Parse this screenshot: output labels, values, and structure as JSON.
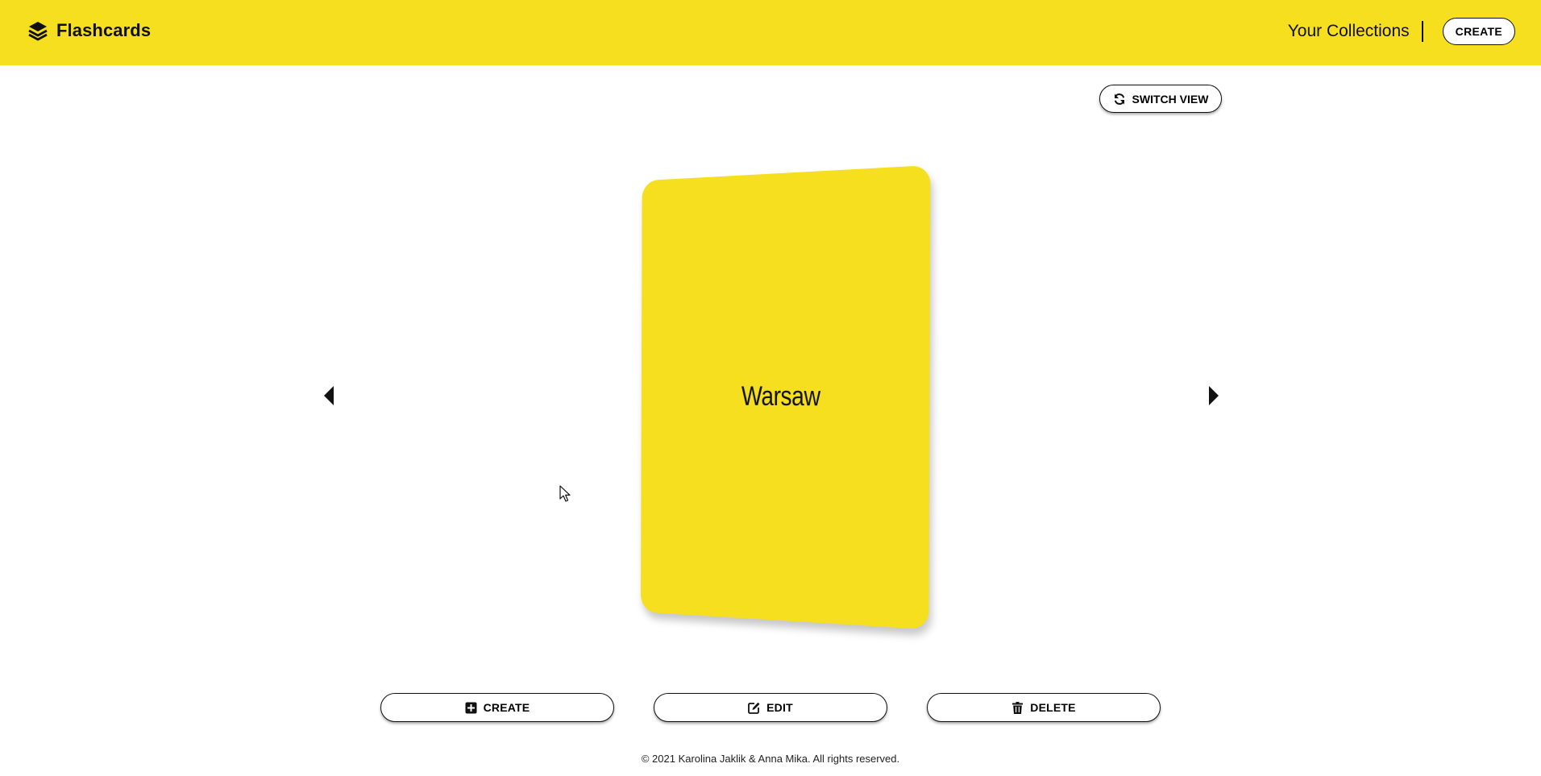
{
  "header": {
    "brand": "Flashcards",
    "brand_icon": "layers-icon",
    "nav_link": "Your Collections",
    "create_label": "CREATE",
    "color": "#f5df1e"
  },
  "toolbar": {
    "switch_view_label": "SWITCH VIEW",
    "switch_icon": "sync-icon"
  },
  "card": {
    "text": "Warsaw",
    "color": "#f5df1e"
  },
  "navigation": {
    "prev_icon": "caret-left-icon",
    "next_icon": "caret-right-icon"
  },
  "actions": {
    "create_label": "CREATE",
    "edit_label": "EDIT",
    "delete_label": "DELETE",
    "create_icon": "plus-square-icon",
    "edit_icon": "edit-icon",
    "delete_icon": "trash-icon"
  },
  "footer": {
    "text": "© 2021 Karolina Jaklik & Anna Mika. All rights reserved."
  }
}
